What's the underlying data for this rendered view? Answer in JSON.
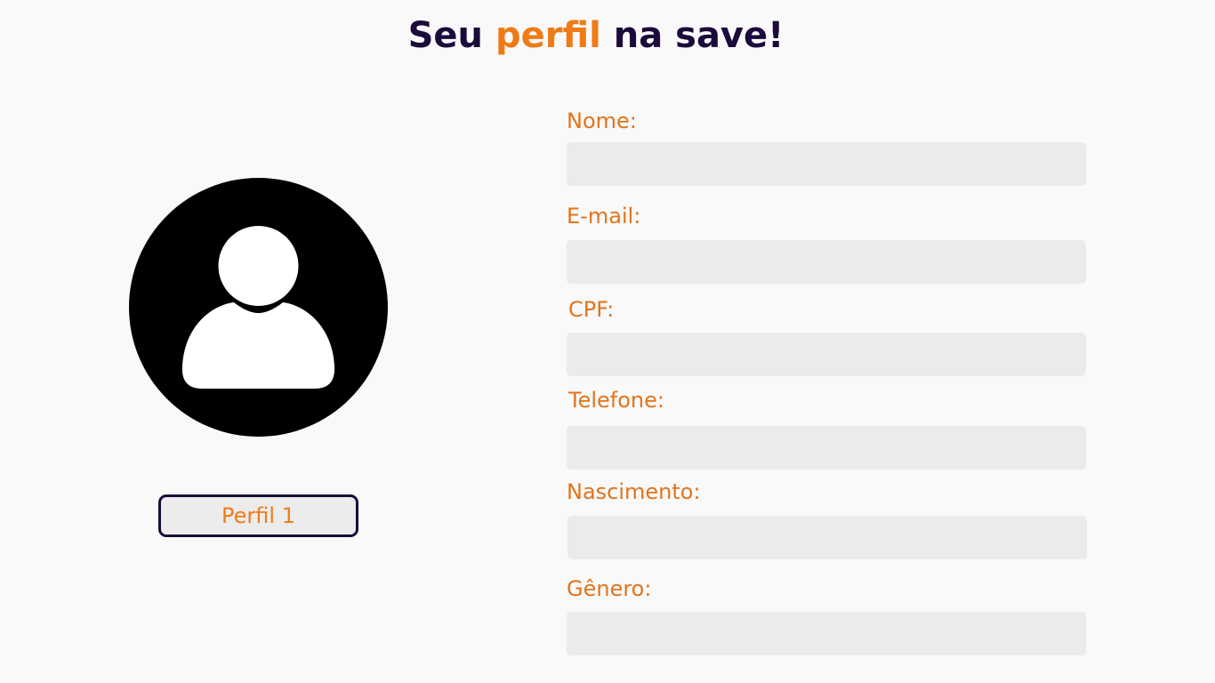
{
  "title": {
    "part1": "Seu ",
    "accent": "perfil",
    "part2": " na save!"
  },
  "colors": {
    "accent": "#f07a16",
    "dark": "#1b0b3a",
    "input_bg": "#ebebeb",
    "background": "#f9f9f9"
  },
  "avatar": {
    "icon": "user-avatar-icon"
  },
  "profile_button": {
    "label": "Perfil 1"
  },
  "form": {
    "nome": {
      "label": "Nome:",
      "value": ""
    },
    "email": {
      "label": "E-mail:",
      "value": ""
    },
    "cpf": {
      "label": "CPF:",
      "value": ""
    },
    "telefone": {
      "label": "Telefone:",
      "value": ""
    },
    "nascimento": {
      "label": "Nascimento:",
      "value": ""
    },
    "genero": {
      "label": "Gênero:",
      "value": ""
    }
  }
}
